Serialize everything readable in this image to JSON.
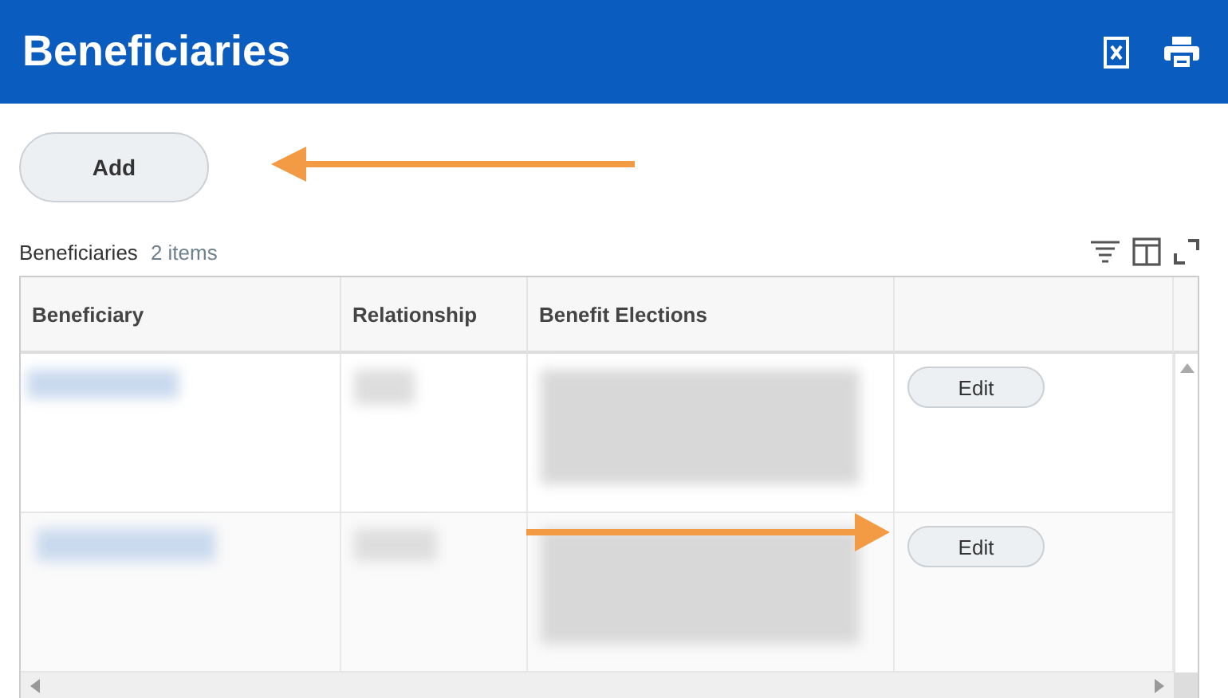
{
  "header": {
    "title": "Beneficiaries"
  },
  "add_button": {
    "label": "Add"
  },
  "table": {
    "title": "Beneficiaries",
    "count": "2 items",
    "columns": [
      "Beneficiary",
      "Relationship",
      "Benefit Elections"
    ],
    "rows": [
      {
        "action": "Edit"
      },
      {
        "action": "Edit"
      }
    ]
  }
}
